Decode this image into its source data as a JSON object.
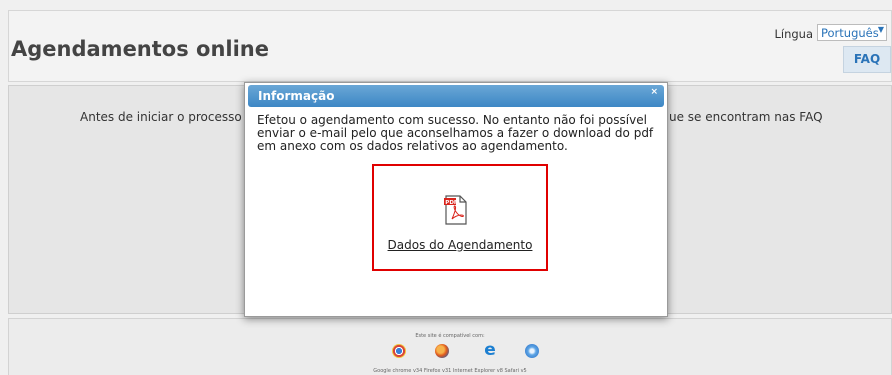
{
  "header": {
    "title": "Agendamentos online",
    "language_label": "Língua",
    "language_value": "Português",
    "faq_label": "FAQ"
  },
  "content": {
    "intro_left": "Antes de iniciar o processo",
    "intro_right": "ue se encontram nas FAQ"
  },
  "footer": {
    "compat_text": "Este site é compatível com:",
    "browsers_text": "Google chrome v34  Firefox v31  Internet Explorer v8  Safari v5"
  },
  "modal": {
    "title": "Informação",
    "close": "×",
    "message": "Efetou o agendamento com sucesso. No entanto não foi possível enviar o e-mail pelo que aconselhamos a fazer o download do pdf em anexo com os dados relativos ao agendamento.",
    "link_label": "Dados do Agendamento",
    "pdf_icon_text": "PDF"
  },
  "colors": {
    "accent": "#2a73b8",
    "titlebar": "#3d87c5",
    "highlight": "#e00000"
  }
}
